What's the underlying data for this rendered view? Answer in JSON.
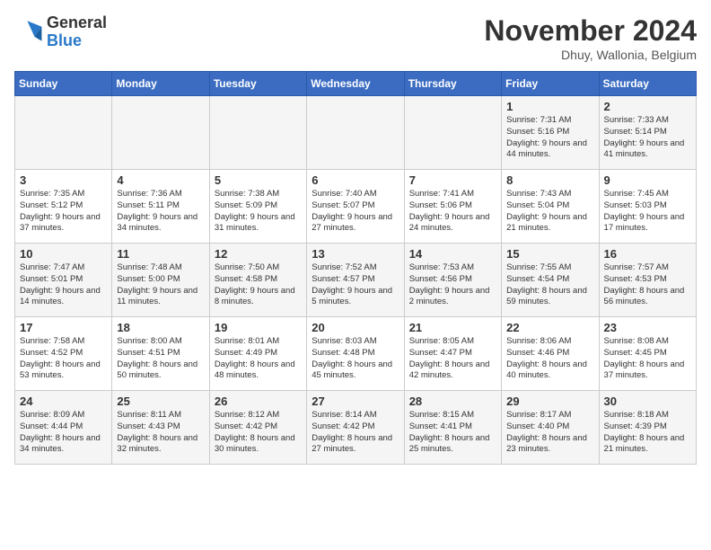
{
  "logo": {
    "text_general": "General",
    "text_blue": "Blue"
  },
  "header": {
    "month": "November 2024",
    "location": "Dhuy, Wallonia, Belgium"
  },
  "weekdays": [
    "Sunday",
    "Monday",
    "Tuesday",
    "Wednesday",
    "Thursday",
    "Friday",
    "Saturday"
  ],
  "weeks": [
    [
      {
        "day": "",
        "info": ""
      },
      {
        "day": "",
        "info": ""
      },
      {
        "day": "",
        "info": ""
      },
      {
        "day": "",
        "info": ""
      },
      {
        "day": "",
        "info": ""
      },
      {
        "day": "1",
        "info": "Sunrise: 7:31 AM\nSunset: 5:16 PM\nDaylight: 9 hours and 44 minutes."
      },
      {
        "day": "2",
        "info": "Sunrise: 7:33 AM\nSunset: 5:14 PM\nDaylight: 9 hours and 41 minutes."
      }
    ],
    [
      {
        "day": "3",
        "info": "Sunrise: 7:35 AM\nSunset: 5:12 PM\nDaylight: 9 hours and 37 minutes."
      },
      {
        "day": "4",
        "info": "Sunrise: 7:36 AM\nSunset: 5:11 PM\nDaylight: 9 hours and 34 minutes."
      },
      {
        "day": "5",
        "info": "Sunrise: 7:38 AM\nSunset: 5:09 PM\nDaylight: 9 hours and 31 minutes."
      },
      {
        "day": "6",
        "info": "Sunrise: 7:40 AM\nSunset: 5:07 PM\nDaylight: 9 hours and 27 minutes."
      },
      {
        "day": "7",
        "info": "Sunrise: 7:41 AM\nSunset: 5:06 PM\nDaylight: 9 hours and 24 minutes."
      },
      {
        "day": "8",
        "info": "Sunrise: 7:43 AM\nSunset: 5:04 PM\nDaylight: 9 hours and 21 minutes."
      },
      {
        "day": "9",
        "info": "Sunrise: 7:45 AM\nSunset: 5:03 PM\nDaylight: 9 hours and 17 minutes."
      }
    ],
    [
      {
        "day": "10",
        "info": "Sunrise: 7:47 AM\nSunset: 5:01 PM\nDaylight: 9 hours and 14 minutes."
      },
      {
        "day": "11",
        "info": "Sunrise: 7:48 AM\nSunset: 5:00 PM\nDaylight: 9 hours and 11 minutes."
      },
      {
        "day": "12",
        "info": "Sunrise: 7:50 AM\nSunset: 4:58 PM\nDaylight: 9 hours and 8 minutes."
      },
      {
        "day": "13",
        "info": "Sunrise: 7:52 AM\nSunset: 4:57 PM\nDaylight: 9 hours and 5 minutes."
      },
      {
        "day": "14",
        "info": "Sunrise: 7:53 AM\nSunset: 4:56 PM\nDaylight: 9 hours and 2 minutes."
      },
      {
        "day": "15",
        "info": "Sunrise: 7:55 AM\nSunset: 4:54 PM\nDaylight: 8 hours and 59 minutes."
      },
      {
        "day": "16",
        "info": "Sunrise: 7:57 AM\nSunset: 4:53 PM\nDaylight: 8 hours and 56 minutes."
      }
    ],
    [
      {
        "day": "17",
        "info": "Sunrise: 7:58 AM\nSunset: 4:52 PM\nDaylight: 8 hours and 53 minutes."
      },
      {
        "day": "18",
        "info": "Sunrise: 8:00 AM\nSunset: 4:51 PM\nDaylight: 8 hours and 50 minutes."
      },
      {
        "day": "19",
        "info": "Sunrise: 8:01 AM\nSunset: 4:49 PM\nDaylight: 8 hours and 48 minutes."
      },
      {
        "day": "20",
        "info": "Sunrise: 8:03 AM\nSunset: 4:48 PM\nDaylight: 8 hours and 45 minutes."
      },
      {
        "day": "21",
        "info": "Sunrise: 8:05 AM\nSunset: 4:47 PM\nDaylight: 8 hours and 42 minutes."
      },
      {
        "day": "22",
        "info": "Sunrise: 8:06 AM\nSunset: 4:46 PM\nDaylight: 8 hours and 40 minutes."
      },
      {
        "day": "23",
        "info": "Sunrise: 8:08 AM\nSunset: 4:45 PM\nDaylight: 8 hours and 37 minutes."
      }
    ],
    [
      {
        "day": "24",
        "info": "Sunrise: 8:09 AM\nSunset: 4:44 PM\nDaylight: 8 hours and 34 minutes."
      },
      {
        "day": "25",
        "info": "Sunrise: 8:11 AM\nSunset: 4:43 PM\nDaylight: 8 hours and 32 minutes."
      },
      {
        "day": "26",
        "info": "Sunrise: 8:12 AM\nSunset: 4:42 PM\nDaylight: 8 hours and 30 minutes."
      },
      {
        "day": "27",
        "info": "Sunrise: 8:14 AM\nSunset: 4:42 PM\nDaylight: 8 hours and 27 minutes."
      },
      {
        "day": "28",
        "info": "Sunrise: 8:15 AM\nSunset: 4:41 PM\nDaylight: 8 hours and 25 minutes."
      },
      {
        "day": "29",
        "info": "Sunrise: 8:17 AM\nSunset: 4:40 PM\nDaylight: 8 hours and 23 minutes."
      },
      {
        "day": "30",
        "info": "Sunrise: 8:18 AM\nSunset: 4:39 PM\nDaylight: 8 hours and 21 minutes."
      }
    ]
  ]
}
